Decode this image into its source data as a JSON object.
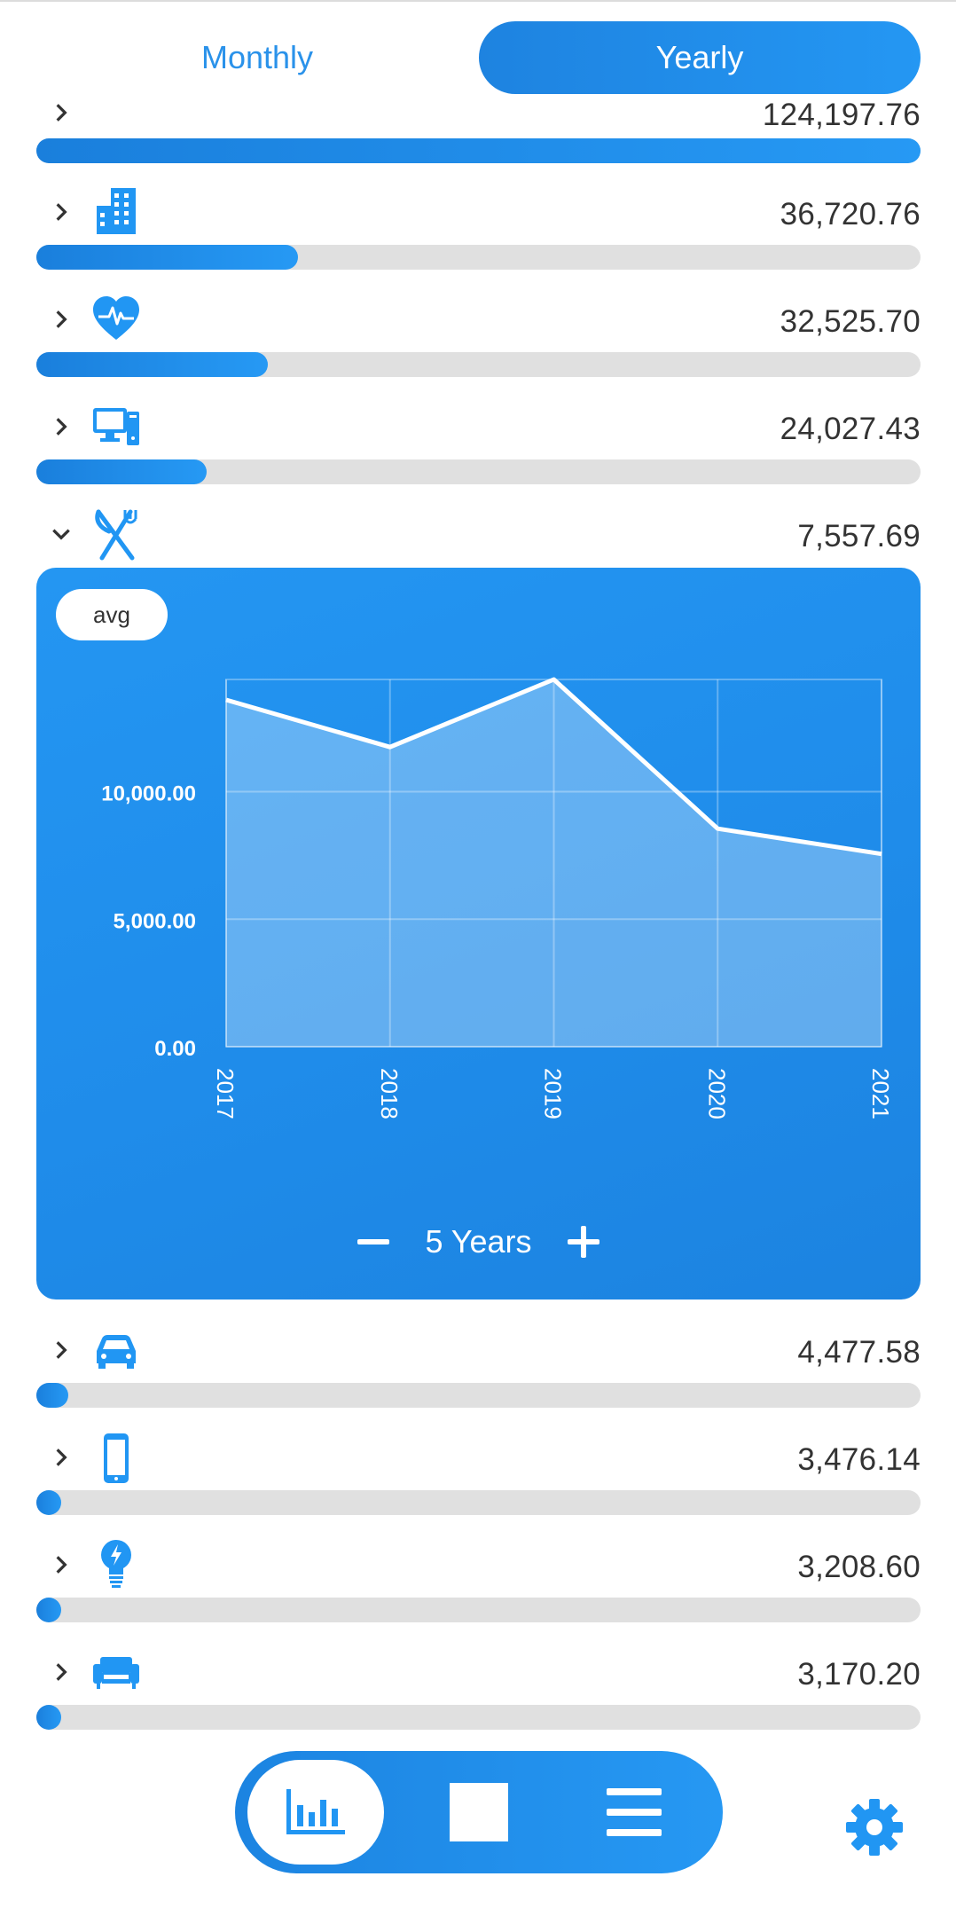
{
  "period_switch": {
    "monthly_label": "Monthly",
    "yearly_label": "Yearly",
    "selected": "Yearly"
  },
  "categories": [
    {
      "icon": "chevron-right-icon",
      "category_icon": null,
      "amount": "124,197.76",
      "share": 1.0
    },
    {
      "icon": "chevron-right-icon",
      "category_icon": "building-icon",
      "amount": "36,720.76",
      "share": 0.296
    },
    {
      "icon": "chevron-right-icon",
      "category_icon": "heart-pulse-icon",
      "amount": "32,525.70",
      "share": 0.262
    },
    {
      "icon": "chevron-right-icon",
      "category_icon": "computer-icon",
      "amount": "24,027.43",
      "share": 0.193
    },
    {
      "icon": "chevron-down-icon",
      "category_icon": "fork-knife-icon",
      "amount": "7,557.69",
      "expanded": true
    },
    {
      "icon": "chevron-right-icon",
      "category_icon": "car-icon",
      "amount": "4,477.58",
      "share": 0.036
    },
    {
      "icon": "chevron-right-icon",
      "category_icon": "phone-icon",
      "amount": "3,476.14",
      "share": 0.028
    },
    {
      "icon": "chevron-right-icon",
      "category_icon": "lightbulb-icon",
      "amount": "3,208.60",
      "share": 0.026
    },
    {
      "icon": "chevron-right-icon",
      "category_icon": "sofa-icon",
      "amount": "3,170.20",
      "share": 0.026
    }
  ],
  "panel": {
    "avg_label": "avg",
    "range_label": "5 Years"
  },
  "chart_data": {
    "type": "area",
    "x": [
      "2017",
      "2018",
      "2019",
      "2020",
      "2021"
    ],
    "values": [
      13600,
      11750,
      14400,
      8550,
      7557.69
    ],
    "y_ticks": [
      "0.00",
      "5,000.00",
      "10,000.00"
    ],
    "ylim": [
      0,
      14400
    ],
    "grid": true
  },
  "colors": {
    "accent": "#2196F3",
    "track": "#E0E0E0",
    "text": "#333333"
  },
  "bottom_nav": {
    "items": [
      "bar-chart-icon",
      "square-icon",
      "menu-icon"
    ],
    "active": "bar-chart-icon"
  }
}
